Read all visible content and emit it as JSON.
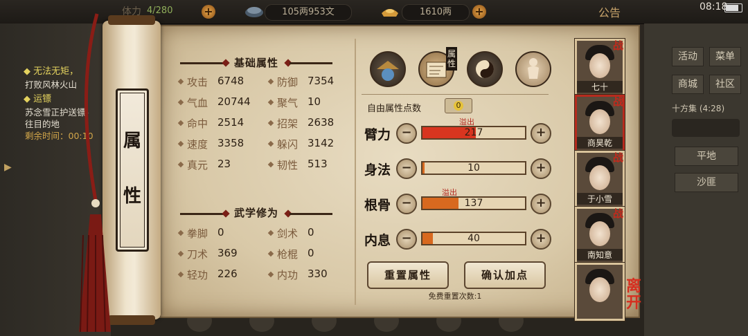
{
  "topbar": {
    "stamina": "4/280",
    "copper": "105两953文",
    "silver": "1610两",
    "notice": "公告",
    "clock": "08:18"
  },
  "quest": {
    "items": [
      {
        "title": "◆ 无法无矩，",
        "lines": [
          "打败风林火山"
        ]
      },
      {
        "title": "◆ 运镖",
        "lines": [
          "苏念雪正护送镖-",
          "往目的地",
          "剩余时间：00:10"
        ]
      }
    ]
  },
  "sidebar_tab": {
    "char1": "属",
    "char2": "性"
  },
  "basic": {
    "title": "基础属性",
    "rows": [
      {
        "n1": "攻击",
        "v1": "6748",
        "n2": "防御",
        "v2": "7354"
      },
      {
        "n1": "气血",
        "v1": "20744",
        "n2": "聚气",
        "v2": "10"
      },
      {
        "n1": "命中",
        "v1": "2514",
        "n2": "招架",
        "v2": "2638"
      },
      {
        "n1": "速度",
        "v1": "3358",
        "n2": "躲闪",
        "v2": "3142"
      },
      {
        "n1": "真元",
        "v1": "23",
        "n2": "韧性",
        "v2": "513"
      }
    ]
  },
  "martial": {
    "title": "武学修为",
    "rows": [
      {
        "n1": "拳脚",
        "v1": "0",
        "n2": "剑术",
        "v2": "0"
      },
      {
        "n1": "刀术",
        "v1": "369",
        "n2": "枪棍",
        "v2": "0"
      },
      {
        "n1": "轻功",
        "v1": "226",
        "n2": "内功",
        "v2": "330"
      }
    ]
  },
  "attr_tab_label": "属性",
  "free_points": {
    "label": "自由属性点数",
    "value": "0"
  },
  "stats": [
    {
      "label": "臂力",
      "value": "217",
      "fill": 0.52,
      "overflow": "溢出",
      "color": "#d8351f"
    },
    {
      "label": "身法",
      "value": "10",
      "fill": 0.02,
      "overflow": "",
      "color": "#d8691f"
    },
    {
      "label": "根骨",
      "value": "137",
      "fill": 0.35,
      "overflow": "溢出",
      "color": "#d8691f"
    },
    {
      "label": "内息",
      "value": "40",
      "fill": 0.1,
      "overflow": "",
      "color": "#d8691f"
    }
  ],
  "buttons": {
    "reset": "重置属性",
    "confirm": "确认加点",
    "free_reset": "免费重置次数:1"
  },
  "characters": [
    {
      "name": "七十",
      "war": "战"
    },
    {
      "name": "商昊乾",
      "war": "战"
    },
    {
      "name": "于小雪",
      "war": "战"
    },
    {
      "name": "南知意",
      "war": "战"
    },
    {
      "name": "",
      "war": ""
    }
  ],
  "leave": "离开",
  "right_menu": {
    "b1": "活动",
    "b2": "菜单",
    "b3": "商城",
    "b4": "社区",
    "region": "十方集 (4:28)",
    "terrain1": "平地",
    "terrain2": "沙匪"
  },
  "colors": {
    "accent_red": "#b72b1e",
    "paper": "#e2d4b6",
    "bar_red": "#d8351f",
    "bar_orange": "#d8691f"
  }
}
